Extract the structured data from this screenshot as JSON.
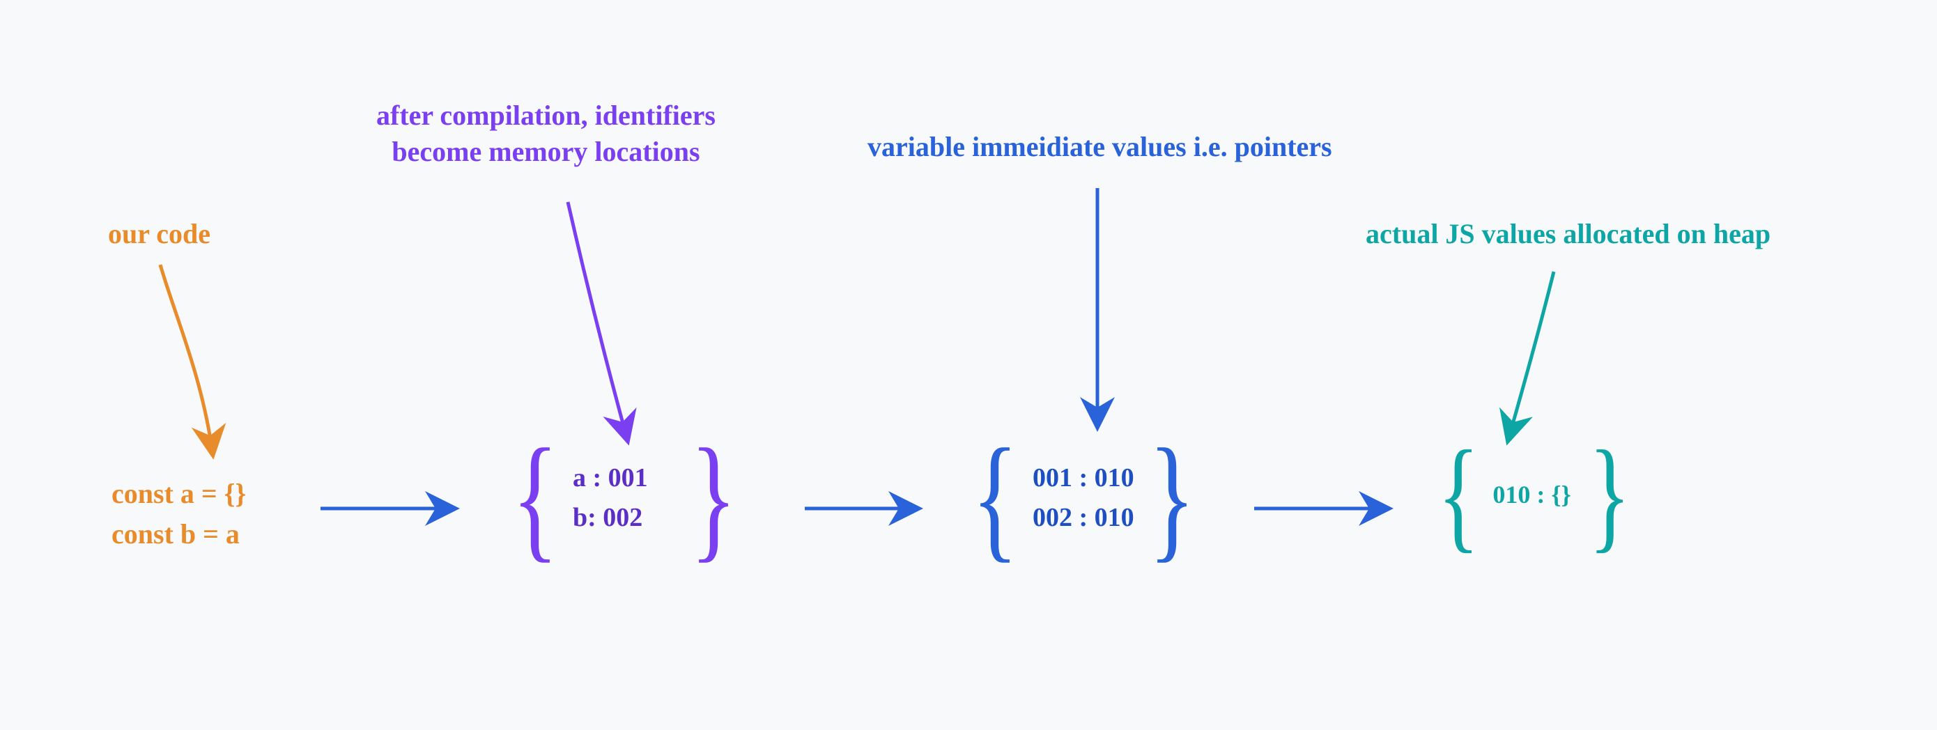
{
  "labels": {
    "our_code": "our code",
    "compilation": "after compilation, identifiers\nbecome memory locations",
    "pointers": "variable immeidiate values i.e. pointers",
    "heap": "actual JS values allocated on heap"
  },
  "code": {
    "line1": "const a = {}",
    "line2": "const b = a"
  },
  "group1": {
    "line1": "a : 001",
    "line2": "b: 002"
  },
  "group2": {
    "line1": "001 : 010",
    "line2": "002 : 010"
  },
  "group3": {
    "line1": "010 : {}"
  },
  "colors": {
    "orange": "#e88c2b",
    "purple": "#7b3ff2",
    "blue": "#2962d9",
    "teal": "#0ea5a5"
  }
}
